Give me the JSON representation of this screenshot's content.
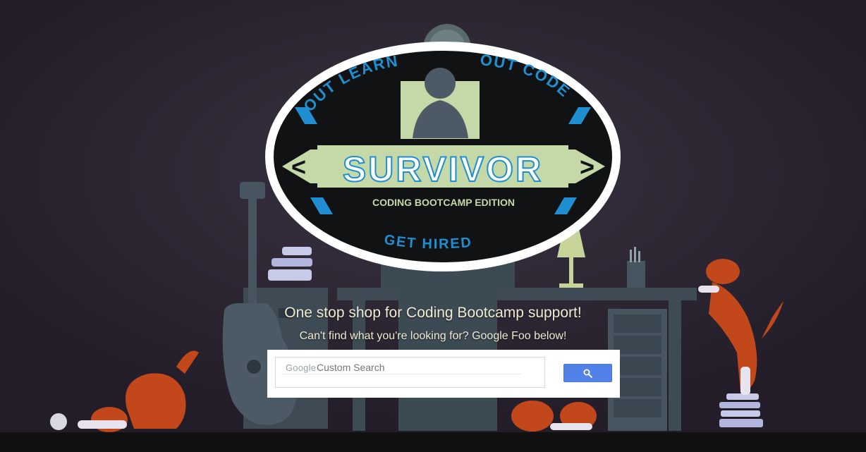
{
  "logo": {
    "arc_top_left": "OUT LEARN",
    "arc_top_right": "OUT CODE",
    "title": "SURVIVOR",
    "subtitle": "CODING BOOTCAMP EDITION",
    "arc_bottom": "GET HIRED"
  },
  "hero": {
    "headline": "One stop shop for Coding Bootcamp support!",
    "subheadline": "Can't find what you're looking for? Google Foo below!"
  },
  "search": {
    "brand": "Google",
    "placeholder": "Custom Search",
    "button_icon": "search-icon"
  },
  "colors": {
    "background": "#2a2330",
    "tagline_text": "#f0ebd2",
    "logo_green": "#c5d9a8",
    "logo_blue": "#1f8fd1",
    "search_button": "#5282e8",
    "dog_orange": "#c2481c"
  }
}
